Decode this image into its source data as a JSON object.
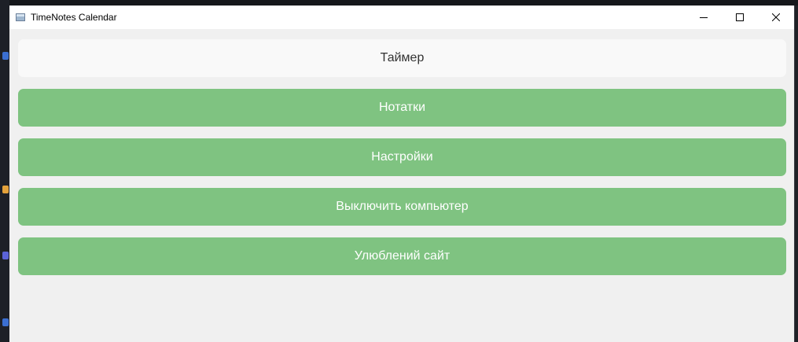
{
  "window": {
    "title": "TimeNotes Calendar"
  },
  "menu": {
    "buttons": [
      {
        "label": "Таймер",
        "style": "light"
      },
      {
        "label": "Нотатки",
        "style": "green"
      },
      {
        "label": "Настройки",
        "style": "green"
      },
      {
        "label": "Выключить компьютер",
        "style": "green"
      },
      {
        "label": "Улюблений сайт",
        "style": "green"
      }
    ]
  },
  "colors": {
    "accent_green": "#7fc381",
    "light_button": "#f9f9f9",
    "window_bg": "#f0f0f0",
    "titlebar_bg": "#ffffff"
  },
  "icons": {
    "app": "app-window-icon",
    "minimize": "minimize-icon",
    "maximize": "maximize-icon",
    "close": "close-icon"
  }
}
